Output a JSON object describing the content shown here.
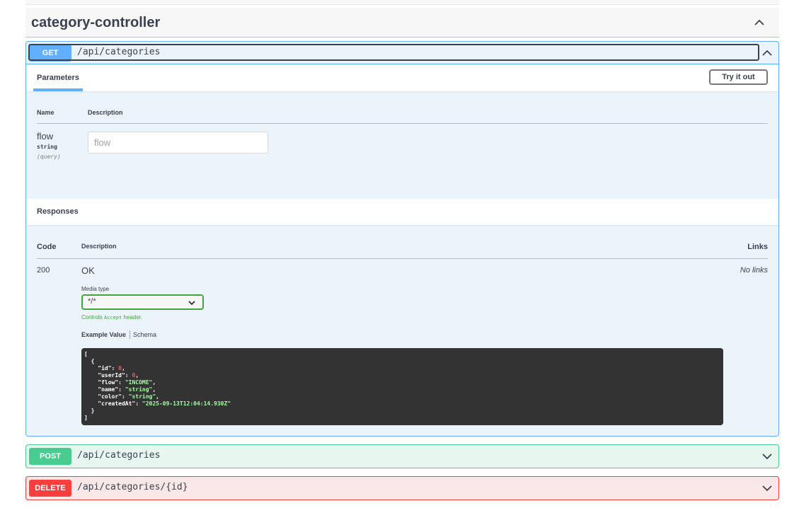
{
  "controller": {
    "title": "category-controller"
  },
  "operations": {
    "get": {
      "method": "GET",
      "path": "/api/categories",
      "parameters_tab": "Parameters",
      "try_button": "Try it out",
      "param_headers": {
        "name": "Name",
        "description": "Description"
      },
      "param": {
        "name": "flow",
        "type": "string",
        "in": "(query)",
        "placeholder": "flow"
      },
      "responses_title": "Responses",
      "resp_headers": {
        "code": "Code",
        "description": "Description",
        "links": "Links"
      },
      "response": {
        "code": "200",
        "description": "OK",
        "links": "No links",
        "media_type_label": "Media type",
        "media_type_value": "*/*",
        "controls_note_prefix": "Controls ",
        "controls_note_code": "Accept",
        "controls_note_suffix": " header.",
        "example_tab": "Example Value",
        "schema_tab": "Schema",
        "example": {
          "open_bracket": "[",
          "open_brace": "{",
          "fields": [
            {
              "key": "\"id\"",
              "value": "0",
              "type": "number",
              "comma": ","
            },
            {
              "key": "\"userId\"",
              "value": "0",
              "type": "number",
              "comma": ","
            },
            {
              "key": "\"flow\"",
              "value": "\"INCOME\"",
              "type": "string",
              "comma": ","
            },
            {
              "key": "\"name\"",
              "value": "\"string\"",
              "type": "string",
              "comma": ","
            },
            {
              "key": "\"color\"",
              "value": "\"string\"",
              "type": "string",
              "comma": ","
            },
            {
              "key": "\"createdAt\"",
              "value": "\"2025-09-13T12:04:14.930Z\"",
              "type": "string",
              "comma": ""
            }
          ],
          "close_brace": "}",
          "close_bracket": "]"
        }
      }
    },
    "post": {
      "method": "POST",
      "path": "/api/categories"
    },
    "delete": {
      "method": "DELETE",
      "path": "/api/categories/{id}"
    }
  },
  "colors": {
    "get": "#61affe",
    "post": "#49cc90",
    "delete": "#f93e3e",
    "get_bg": "#ebf3fb",
    "post_bg": "#e8f6f0",
    "delete_bg": "#fae7e7",
    "code_bg": "#333333",
    "json_number": "#d36363",
    "json_string": "#a2fca2",
    "select_border": "#41a43c"
  },
  "icons": {
    "controller_toggle": "chevron-up-icon",
    "get_toggle": "chevron-up-icon",
    "post_toggle": "chevron-down-icon",
    "delete_toggle": "chevron-down-icon",
    "media_select": "chevron-down-icon"
  }
}
